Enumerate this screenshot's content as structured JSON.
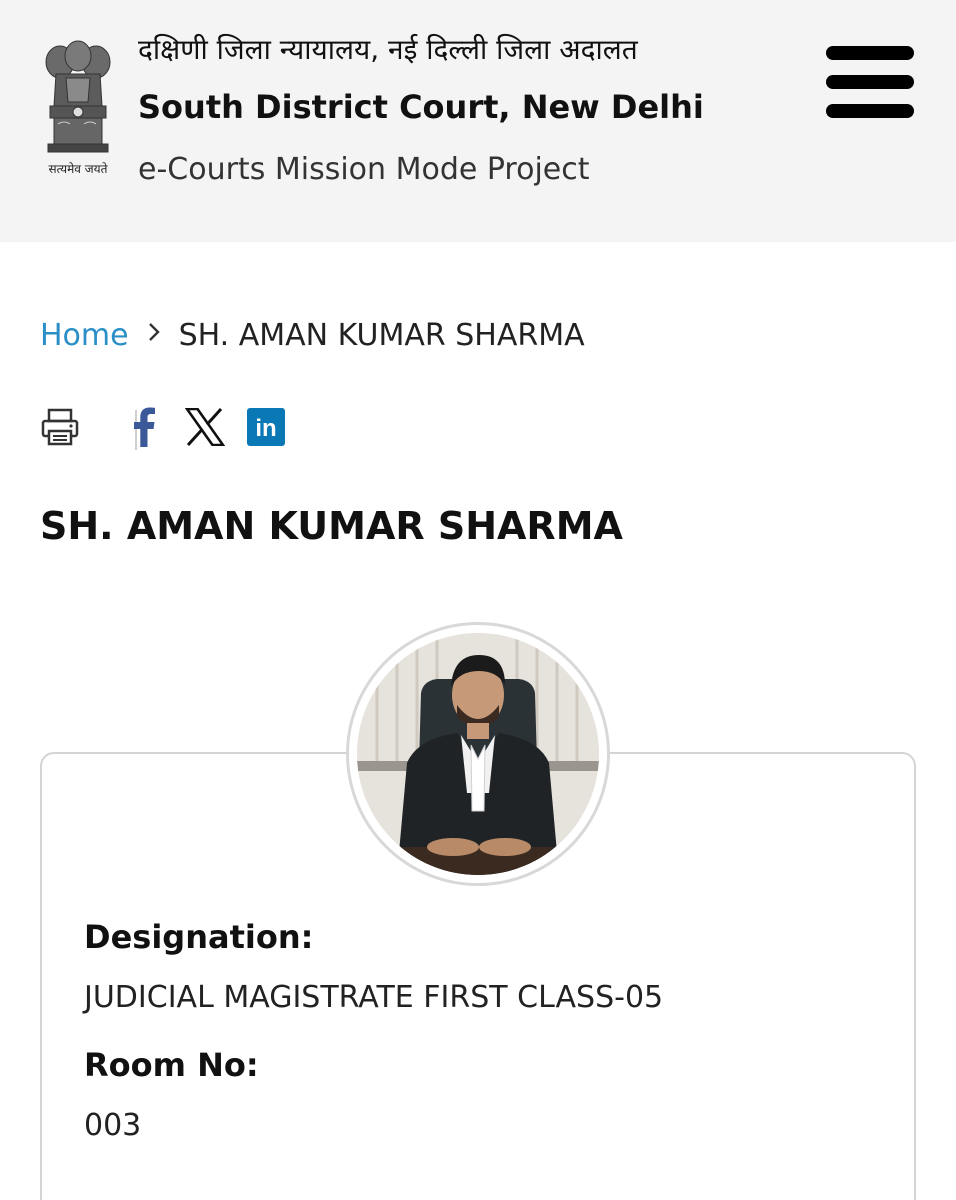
{
  "header": {
    "hindi_title": "दक्षिणी जिला न्यायालय, नई दिल्ली जिला अदालत",
    "english_title": "South District Court, New Delhi",
    "subtitle": "e-Courts Mission Mode Project",
    "emblem_motto": "सत्यमेव जयते",
    "emblem_icon": "national-emblem-icon",
    "menu_icon": "hamburger-menu-icon"
  },
  "breadcrumb": {
    "home": "Home",
    "separator_icon": "chevron-right-icon",
    "current": "SH. AMAN KUMAR SHARMA"
  },
  "share": {
    "items": [
      "print-icon",
      "facebook-icon",
      "x-icon",
      "linkedin-icon"
    ],
    "linkedin_text": "in",
    "colors": {
      "facebook": "#3b5998",
      "x": "#111111",
      "linkedin": "#0a78b5",
      "print": "#333333"
    }
  },
  "profile": {
    "name": "SH. AMAN KUMAR SHARMA",
    "photo_alt": "Portrait of SH. AMAN KUMAR SHARMA",
    "fields": [
      {
        "label": "Designation:",
        "value": "JUDICIAL MAGISTRATE FIRST CLASS-05"
      },
      {
        "label": "Room No:",
        "value": "003"
      }
    ]
  },
  "colors": {
    "link": "#2a8fc6",
    "header_bg": "#f4f4f4",
    "card_border": "#d4d4d4"
  }
}
